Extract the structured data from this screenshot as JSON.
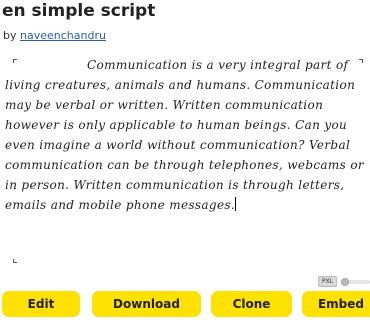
{
  "header": {
    "title": "en simple script",
    "by_label": "by",
    "author": "naveenchandru"
  },
  "editor": {
    "text": "Communication is a very integral part of living creatures, animals and humans. Communication may be verbal or written. Written communication however is only applicable to human beings. Can you even imagine a world without communication? Verbal communication can be through telephones, webcams or in person. Written communication is through letters, emails and mobile phone messages."
  },
  "size_control": {
    "label": "PXL"
  },
  "actions": {
    "edit": "Edit",
    "download": "Download",
    "clone": "Clone",
    "embed": "Embed"
  },
  "colors": {
    "button_bg": "#ffe100",
    "link": "#2a5db0"
  }
}
